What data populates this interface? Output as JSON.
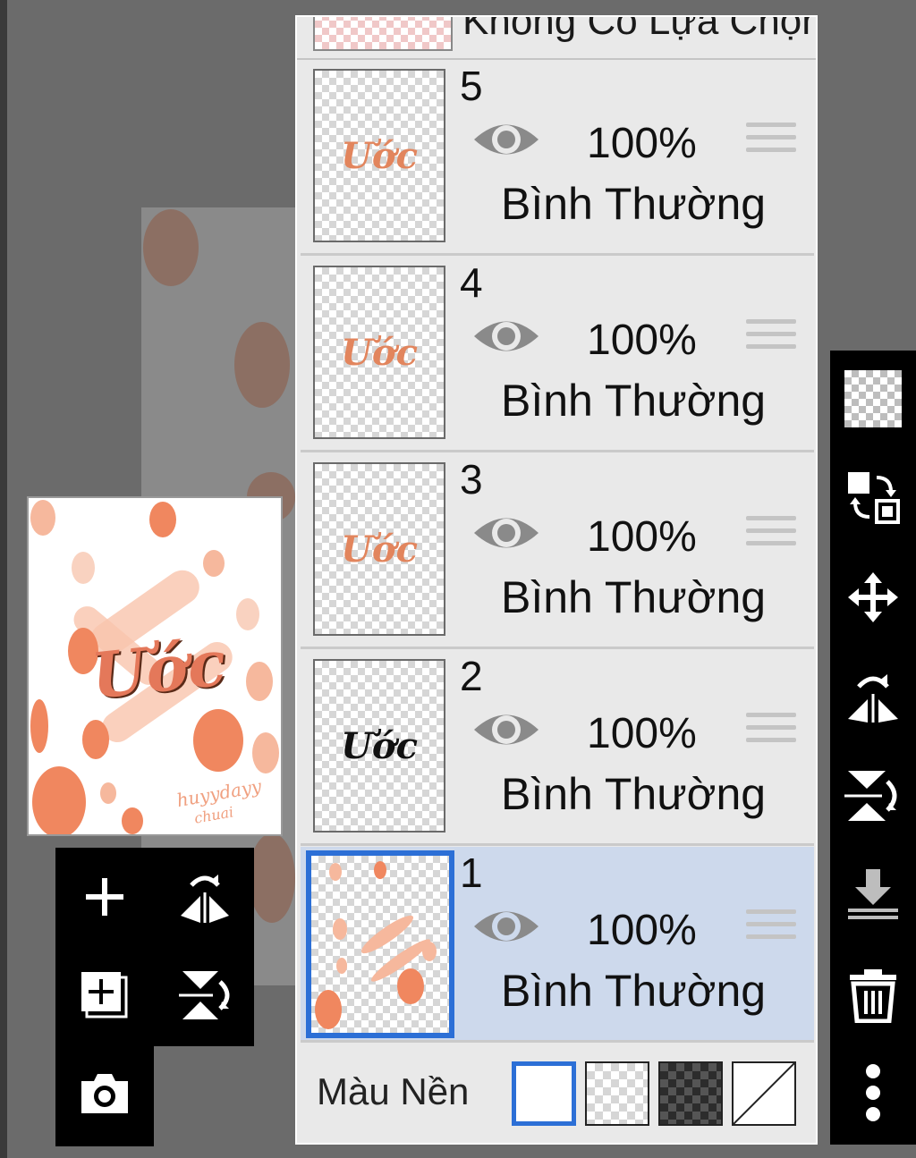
{
  "header": {
    "selection_label": "Không Có Lựa Chọn"
  },
  "preview": {
    "title": "Ước",
    "signature_line1": "huyydayy",
    "signature_line2": "chuai"
  },
  "layers": [
    {
      "number": "5",
      "opacity": "100%",
      "blend_mode": "Bình Thường",
      "thumb_text": "Ước",
      "visible": true,
      "selected": false
    },
    {
      "number": "4",
      "opacity": "100%",
      "blend_mode": "Bình Thường",
      "thumb_text": "Ước",
      "visible": true,
      "selected": false
    },
    {
      "number": "3",
      "opacity": "100%",
      "blend_mode": "Bình Thường",
      "thumb_text": "Ước",
      "visible": true,
      "selected": false
    },
    {
      "number": "2",
      "opacity": "100%",
      "blend_mode": "Bình Thường",
      "thumb_text": "Ước",
      "visible": true,
      "selected": false
    },
    {
      "number": "1",
      "opacity": "100%",
      "blend_mode": "Bình Thường",
      "thumb_text": "",
      "visible": true,
      "selected": true
    }
  ],
  "background": {
    "label": "Màu Nền",
    "options": [
      "white",
      "transparent-checker",
      "dark-checker",
      "none"
    ],
    "selected": "white"
  },
  "left_tools": [
    "add-layer-icon",
    "flip-horizontal-icon",
    "duplicate-layer-icon",
    "flip-vertical-icon",
    "camera-icon"
  ],
  "right_tools": [
    "transparency-icon",
    "swap-icon",
    "move-icon",
    "flip-horizontal-icon",
    "flip-vertical-icon",
    "merge-down-icon",
    "delete-icon",
    "more-icon"
  ],
  "colors": {
    "accent": "#2c6fd6",
    "selected_layer": "#cdd9ec",
    "art_orange": "#f0875f"
  }
}
